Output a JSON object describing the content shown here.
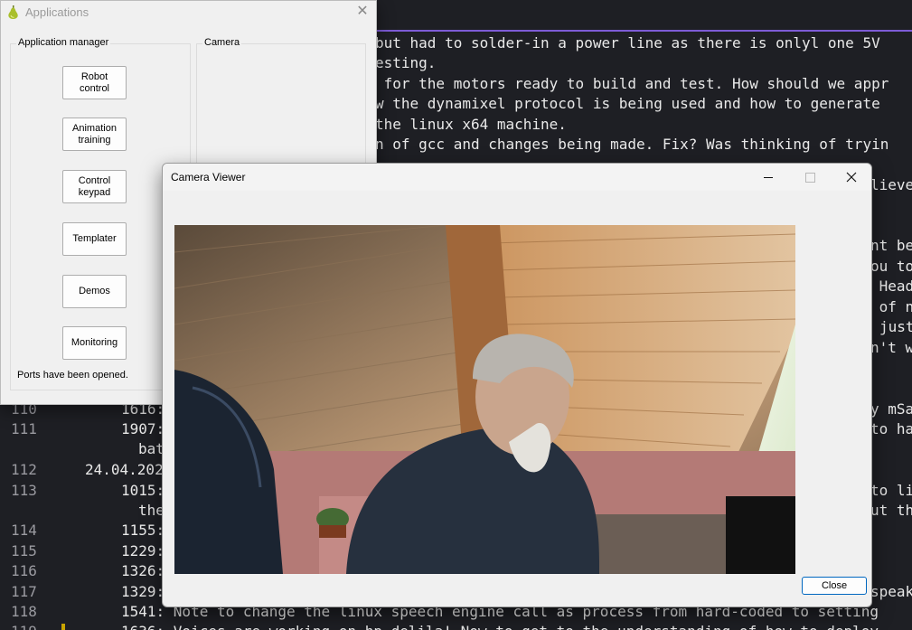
{
  "editor": {
    "lines": [
      {
        "num": "",
        "text": "but had to solder-in a power line as there is onlyl one 5V"
      },
      {
        "num": "",
        "text": "esting."
      },
      {
        "num": "",
        "text": " for the motors ready to build and test. How should we appr"
      },
      {
        "num": "",
        "text": "w the dynamixel protocol is being used and how to generate"
      },
      {
        "num": "",
        "text": "the linux x64 machine."
      },
      {
        "num": "",
        "text": "n of gcc and changes being made. Fix? Was thinking of tryin"
      },
      {
        "num": "",
        "text": "lieve"
      },
      {
        "num": "",
        "text": "nt be"
      },
      {
        "num": "",
        "text": "ou to"
      },
      {
        "num": "",
        "text": " Head"
      },
      {
        "num": "",
        "text": " of n"
      },
      {
        "num": "",
        "text": "just"
      },
      {
        "num": "",
        "text": "n't w"
      },
      {
        "num": "110",
        "text": "1616:",
        "right": "y mSa"
      },
      {
        "num": "111",
        "text": "1907:",
        "right": "to ha"
      },
      {
        "num": "",
        "text": "bat"
      },
      {
        "num": "112",
        "text": "24.04.202"
      },
      {
        "num": "113",
        "text": "1015:",
        "right": "to li"
      },
      {
        "num": "",
        "text": "the",
        "right": "ut tha"
      },
      {
        "num": "114",
        "text": "1155:"
      },
      {
        "num": "115",
        "text": "1229:"
      },
      {
        "num": "116",
        "text": "1326:"
      },
      {
        "num": "117",
        "text": "1329:",
        "right": "speak"
      },
      {
        "num": "118",
        "text": "1541: Note to change the linux speech engine call as process from hard-coded to setting"
      },
      {
        "num": "119",
        "text": "1636: Voices are working on hp delila! Now to get to the understanding of how to deploy"
      }
    ]
  },
  "apps_window": {
    "title": "Applications",
    "group_app_manager": "Application manager",
    "group_camera": "Camera",
    "buttons": {
      "robot_control": "Robot\ncontrol",
      "animation_training": "Animation\ntraining",
      "control_keypad": "Control\nkeypad",
      "templater": "Templater",
      "demos": "Demos",
      "monitoring": "Monitoring"
    },
    "status": "Ports have been opened."
  },
  "camera_window": {
    "title": "Camera Viewer",
    "close_label": "Close"
  }
}
